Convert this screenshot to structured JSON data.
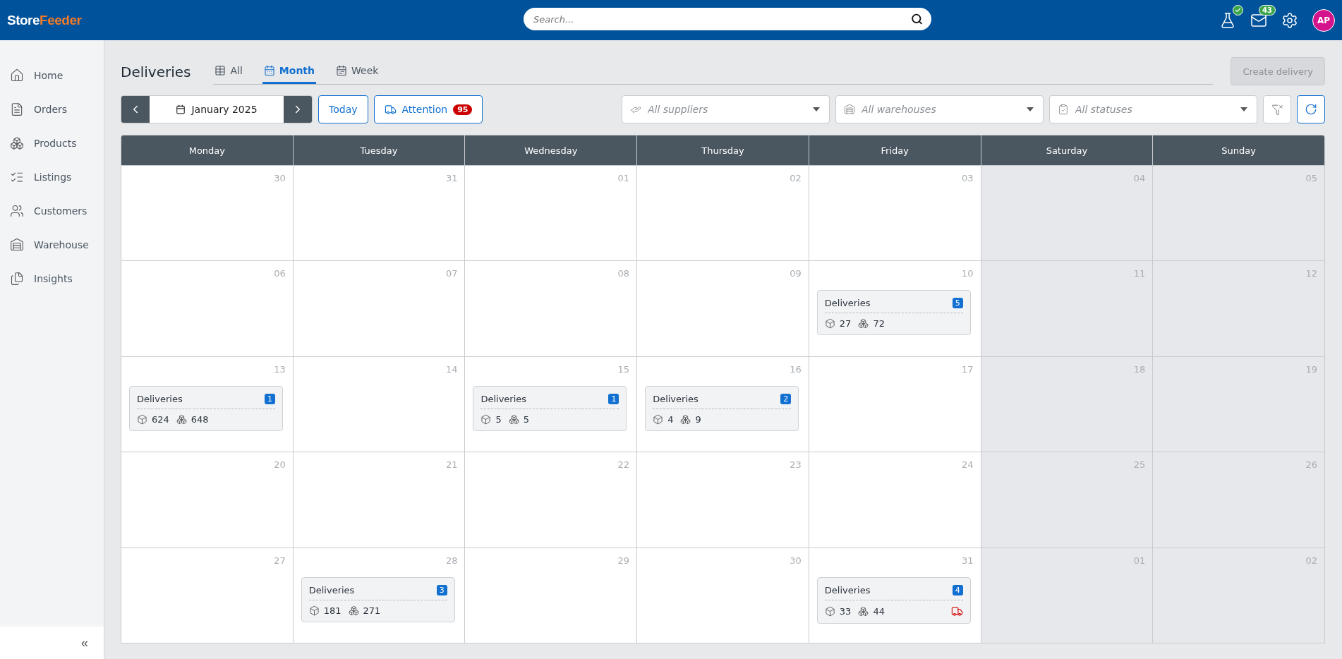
{
  "header": {
    "logo": {
      "first": "Store",
      "second": "Feeder"
    },
    "search": {
      "placeholder": "Search..."
    },
    "lab_status": {
      "ok": true
    },
    "mail": {
      "count": "43"
    },
    "avatar": {
      "initials": "AP"
    }
  },
  "sidebar": {
    "items": [
      {
        "label": "Home",
        "kind": "home"
      },
      {
        "label": "Orders",
        "kind": "orders"
      },
      {
        "label": "Products",
        "kind": "products"
      },
      {
        "label": "Listings",
        "kind": "listings"
      },
      {
        "label": "Customers",
        "kind": "customers"
      },
      {
        "label": "Warehouse",
        "kind": "warehouse"
      },
      {
        "label": "Insights",
        "kind": "insights"
      }
    ],
    "collapse": "«"
  },
  "page": {
    "title": "Deliveries",
    "tabs": [
      {
        "label": "All",
        "kind": "table",
        "selected": false
      },
      {
        "label": "Month",
        "kind": "month",
        "selected": true
      },
      {
        "label": "Week",
        "kind": "week",
        "selected": false
      }
    ],
    "create_button": {
      "label": "Create delivery",
      "disabled": true
    }
  },
  "toolbar": {
    "period": "January 2025",
    "today": "Today",
    "attention": {
      "label": "Attention",
      "count": "95"
    },
    "filters": [
      {
        "placeholder": "All suppliers",
        "kind": "supplier"
      },
      {
        "placeholder": "All warehouses",
        "kind": "warehouse"
      },
      {
        "placeholder": "All statuses",
        "kind": "status"
      }
    ]
  },
  "calendar": {
    "columns": [
      {
        "label": "Monday",
        "weekend": false
      },
      {
        "label": "Tuesday",
        "weekend": false
      },
      {
        "label": "Wednesday",
        "weekend": false
      },
      {
        "label": "Thursday",
        "weekend": false
      },
      {
        "label": "Friday",
        "weekend": false
      },
      {
        "label": "Saturday",
        "weekend": true
      },
      {
        "label": "Sunday",
        "weekend": true
      }
    ],
    "weeks": [
      [
        {
          "day": "30"
        },
        {
          "day": "31"
        },
        {
          "day": "01"
        },
        {
          "day": "02"
        },
        {
          "day": "03"
        },
        {
          "day": "04"
        },
        {
          "day": "05"
        }
      ],
      [
        {
          "day": "06"
        },
        {
          "day": "07"
        },
        {
          "day": "08"
        },
        {
          "day": "09"
        },
        {
          "day": "10",
          "delivery": {
            "title": "Deliveries",
            "count": "5",
            "boxes": "27",
            "packages": "72",
            "alert": false
          }
        },
        {
          "day": "11"
        },
        {
          "day": "12"
        }
      ],
      [
        {
          "day": "13",
          "delivery": {
            "title": "Deliveries",
            "count": "1",
            "boxes": "624",
            "packages": "648",
            "alert": false
          }
        },
        {
          "day": "14"
        },
        {
          "day": "15",
          "delivery": {
            "title": "Deliveries",
            "count": "1",
            "boxes": "5",
            "packages": "5",
            "alert": false
          }
        },
        {
          "day": "16",
          "delivery": {
            "title": "Deliveries",
            "count": "2",
            "boxes": "4",
            "packages": "9",
            "alert": false
          }
        },
        {
          "day": "17"
        },
        {
          "day": "18"
        },
        {
          "day": "19"
        }
      ],
      [
        {
          "day": "20"
        },
        {
          "day": "21"
        },
        {
          "day": "22"
        },
        {
          "day": "23"
        },
        {
          "day": "24"
        },
        {
          "day": "25"
        },
        {
          "day": "26"
        }
      ],
      [
        {
          "day": "27"
        },
        {
          "day": "28",
          "delivery": {
            "title": "Deliveries",
            "count": "3",
            "boxes": "181",
            "packages": "271",
            "alert": false
          }
        },
        {
          "day": "29"
        },
        {
          "day": "30"
        },
        {
          "day": "31",
          "delivery": {
            "title": "Deliveries",
            "count": "4",
            "boxes": "33",
            "packages": "44",
            "alert": true
          }
        },
        {
          "day": "01"
        },
        {
          "day": "02"
        }
      ]
    ]
  }
}
